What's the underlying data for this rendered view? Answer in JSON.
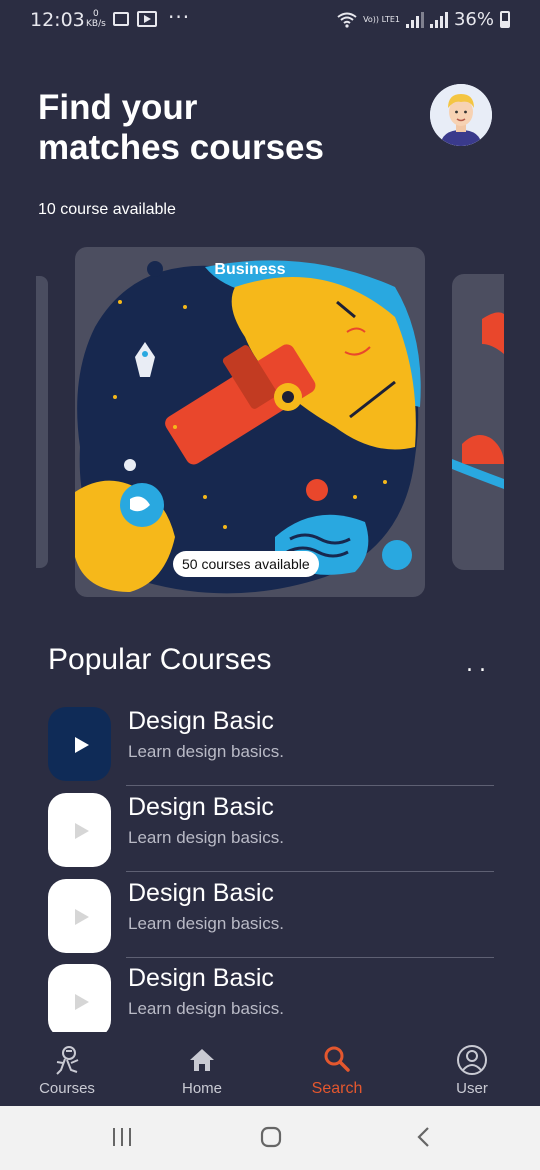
{
  "status_bar": {
    "time": "12:03",
    "data_speed_value": "0",
    "data_speed_unit": "KB/s",
    "network_label": "Vo)) LTE1",
    "battery": "36%"
  },
  "header": {
    "title": "Find your\nmatches courses",
    "subtitle": "10 course available"
  },
  "carousel": {
    "main_card": {
      "category": "Business",
      "count_label": "50 courses available"
    }
  },
  "popular": {
    "title": "Popular Courses",
    "more_label": "..",
    "items": [
      {
        "name": "Design Basic",
        "desc": "Learn design basics.",
        "active": true
      },
      {
        "name": "Design Basic",
        "desc": "Learn design basics.",
        "active": false
      },
      {
        "name": "Design Basic",
        "desc": "Learn design basics.",
        "active": false
      },
      {
        "name": "Design Basic",
        "desc": "Learn design basics.",
        "active": false
      }
    ]
  },
  "bottom_nav": {
    "tabs": [
      {
        "label": "Courses",
        "icon": "astronaut-icon",
        "active": false
      },
      {
        "label": "Home",
        "icon": "home-icon",
        "active": false
      },
      {
        "label": "Search",
        "icon": "search-icon",
        "active": true
      },
      {
        "label": "User",
        "icon": "user-icon",
        "active": false
      }
    ]
  },
  "colors": {
    "background": "#2b2d42",
    "accent": "#e4572e",
    "card": "#4c4e60",
    "active_thumb": "#0f2b57"
  }
}
